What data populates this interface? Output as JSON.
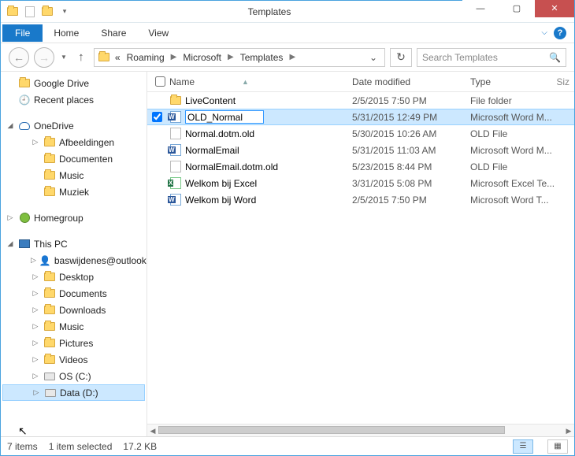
{
  "window": {
    "title": "Templates"
  },
  "ribbon": {
    "file": "File",
    "tabs": [
      "Home",
      "Share",
      "View"
    ]
  },
  "breadcrumb": {
    "prefix": "«",
    "items": [
      "Roaming",
      "Microsoft",
      "Templates"
    ]
  },
  "search": {
    "placeholder": "Search Templates"
  },
  "columns": {
    "name": "Name",
    "date": "Date modified",
    "type": "Type",
    "size": "Siz"
  },
  "tree": {
    "quick": [
      {
        "label": "Google Drive",
        "icon": "folder"
      },
      {
        "label": "Recent places",
        "icon": "recent"
      }
    ],
    "onedrive": {
      "label": "OneDrive",
      "children": [
        {
          "label": "Afbeeldingen"
        },
        {
          "label": "Documenten"
        },
        {
          "label": "Music"
        },
        {
          "label": "Muziek"
        }
      ]
    },
    "homegroup": {
      "label": "Homegroup"
    },
    "thispc": {
      "label": "This PC",
      "children": [
        {
          "label": "baswijdenes@outlook",
          "icon": "account"
        },
        {
          "label": "Desktop",
          "icon": "folder"
        },
        {
          "label": "Documents",
          "icon": "folder"
        },
        {
          "label": "Downloads",
          "icon": "folder"
        },
        {
          "label": "Music",
          "icon": "folder"
        },
        {
          "label": "Pictures",
          "icon": "folder"
        },
        {
          "label": "Videos",
          "icon": "folder"
        },
        {
          "label": "OS (C:)",
          "icon": "drive"
        },
        {
          "label": "Data (D:)",
          "icon": "drive",
          "selected": true
        }
      ]
    }
  },
  "files": [
    {
      "name": "LiveContent",
      "date": "2/5/2015 7:50 PM",
      "type": "File folder",
      "icon": "folder"
    },
    {
      "name": "OLD_Normal",
      "date": "5/31/2015 12:49 PM",
      "type": "Microsoft Word M...",
      "icon": "word",
      "selected": true,
      "checked": true,
      "renaming": true
    },
    {
      "name": "Normal.dotm.old",
      "date": "5/30/2015 10:26 AM",
      "type": "OLD File",
      "icon": "blank"
    },
    {
      "name": "NormalEmail",
      "date": "5/31/2015 11:03 AM",
      "type": "Microsoft Word M...",
      "icon": "word"
    },
    {
      "name": "NormalEmail.dotm.old",
      "date": "5/23/2015 8:44 PM",
      "type": "OLD File",
      "icon": "blank"
    },
    {
      "name": "Welkom bij Excel",
      "date": "3/31/2015 5:08 PM",
      "type": "Microsoft Excel Te...",
      "icon": "excel"
    },
    {
      "name": "Welkom bij Word",
      "date": "2/5/2015 7:50 PM",
      "type": "Microsoft Word T...",
      "icon": "word"
    }
  ],
  "status": {
    "count": "7 items",
    "selected": "1 item selected",
    "size": "17.2 KB"
  }
}
